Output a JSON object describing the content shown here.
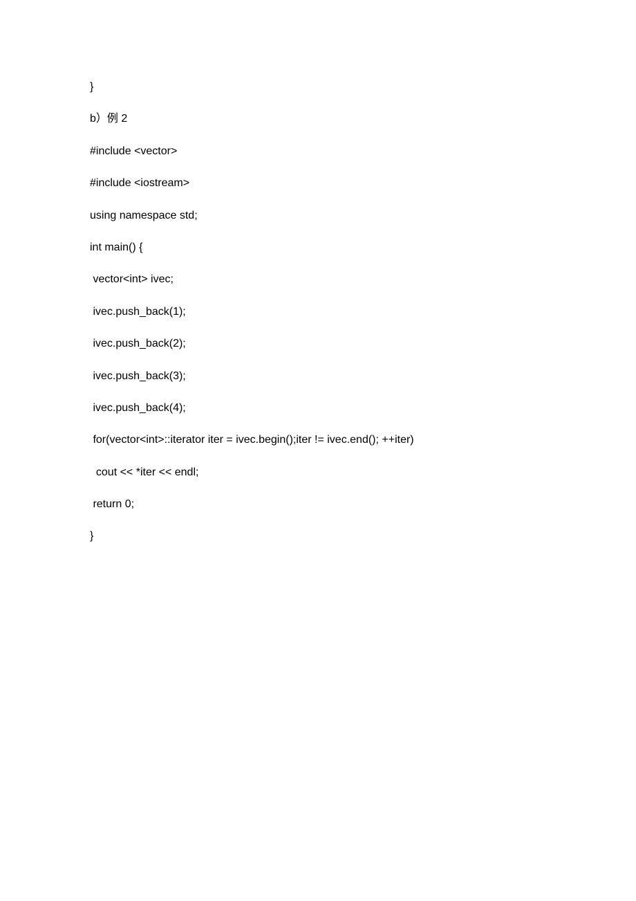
{
  "lines": [
    "}",
    "b）例 2",
    "#include <vector>",
    "#include <iostream>",
    "using namespace std;",
    "int main() {",
    " vector<int> ivec;",
    " ivec.push_back(1);",
    " ivec.push_back(2);",
    " ivec.push_back(3);",
    " ivec.push_back(4);",
    " for(vector<int>::iterator iter = ivec.begin();iter != ivec.end(); ++iter)",
    "  cout << *iter << endl;",
    " return 0;",
    "}"
  ]
}
